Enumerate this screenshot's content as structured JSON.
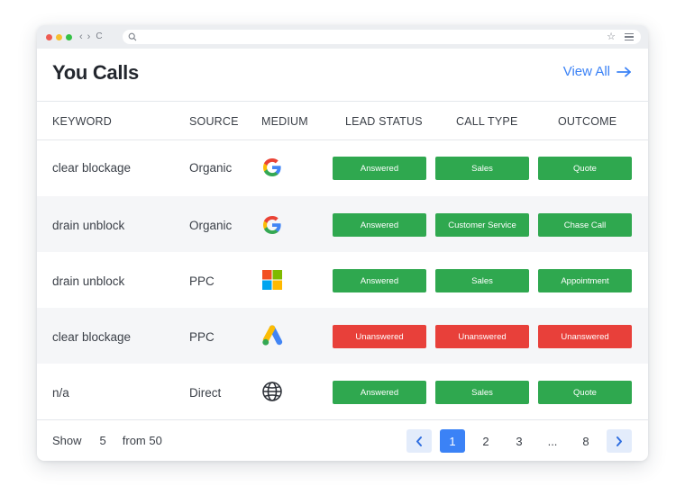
{
  "colors": {
    "green": "#2fa84f",
    "red": "#e8403a",
    "accent": "#3b82f6"
  },
  "browser": {
    "nav_back": "‹",
    "nav_forward": "›",
    "reload": "C"
  },
  "header": {
    "title": "You Calls",
    "view_all": "View All"
  },
  "table": {
    "columns": [
      "KEYWORD",
      "SOURCE",
      "MEDIUM",
      "LEAD STATUS",
      "CALL TYPE",
      "OUTCOME"
    ],
    "rows": [
      {
        "keyword": "clear blockage",
        "source": "Organic",
        "medium": "google-icon",
        "lead_status": "Answered",
        "lead_color": "green",
        "call_type": "Sales",
        "call_color": "green",
        "outcome": "Quote",
        "outcome_color": "green"
      },
      {
        "keyword": "drain unblock",
        "source": "Organic",
        "medium": "google-icon",
        "lead_status": "Answered",
        "lead_color": "green",
        "call_type": "Customer Service",
        "call_color": "green",
        "outcome": "Chase Call",
        "outcome_color": "green"
      },
      {
        "keyword": "drain unblock",
        "source": "PPC",
        "medium": "microsoft-icon",
        "lead_status": "Answered",
        "lead_color": "green",
        "call_type": "Sales",
        "call_color": "green",
        "outcome": "Appointment",
        "outcome_color": "green"
      },
      {
        "keyword": "clear blockage",
        "source": "PPC",
        "medium": "google-ads-icon",
        "lead_status": "Unanswered",
        "lead_color": "red",
        "call_type": "Unanswered",
        "call_color": "red",
        "outcome": "Unanswered",
        "outcome_color": "red"
      },
      {
        "keyword": "n/a",
        "source": "Direct",
        "medium": "globe-icon",
        "lead_status": "Answered",
        "lead_color": "green",
        "call_type": "Sales",
        "call_color": "green",
        "outcome": "Quote",
        "outcome_color": "green"
      }
    ]
  },
  "footer": {
    "show_label": "Show",
    "show_count": "5",
    "from_label": "from 50"
  },
  "pagination": {
    "prev": "‹",
    "next": "›",
    "pages": [
      "1",
      "2",
      "3",
      "...",
      "8"
    ],
    "current": "1"
  }
}
